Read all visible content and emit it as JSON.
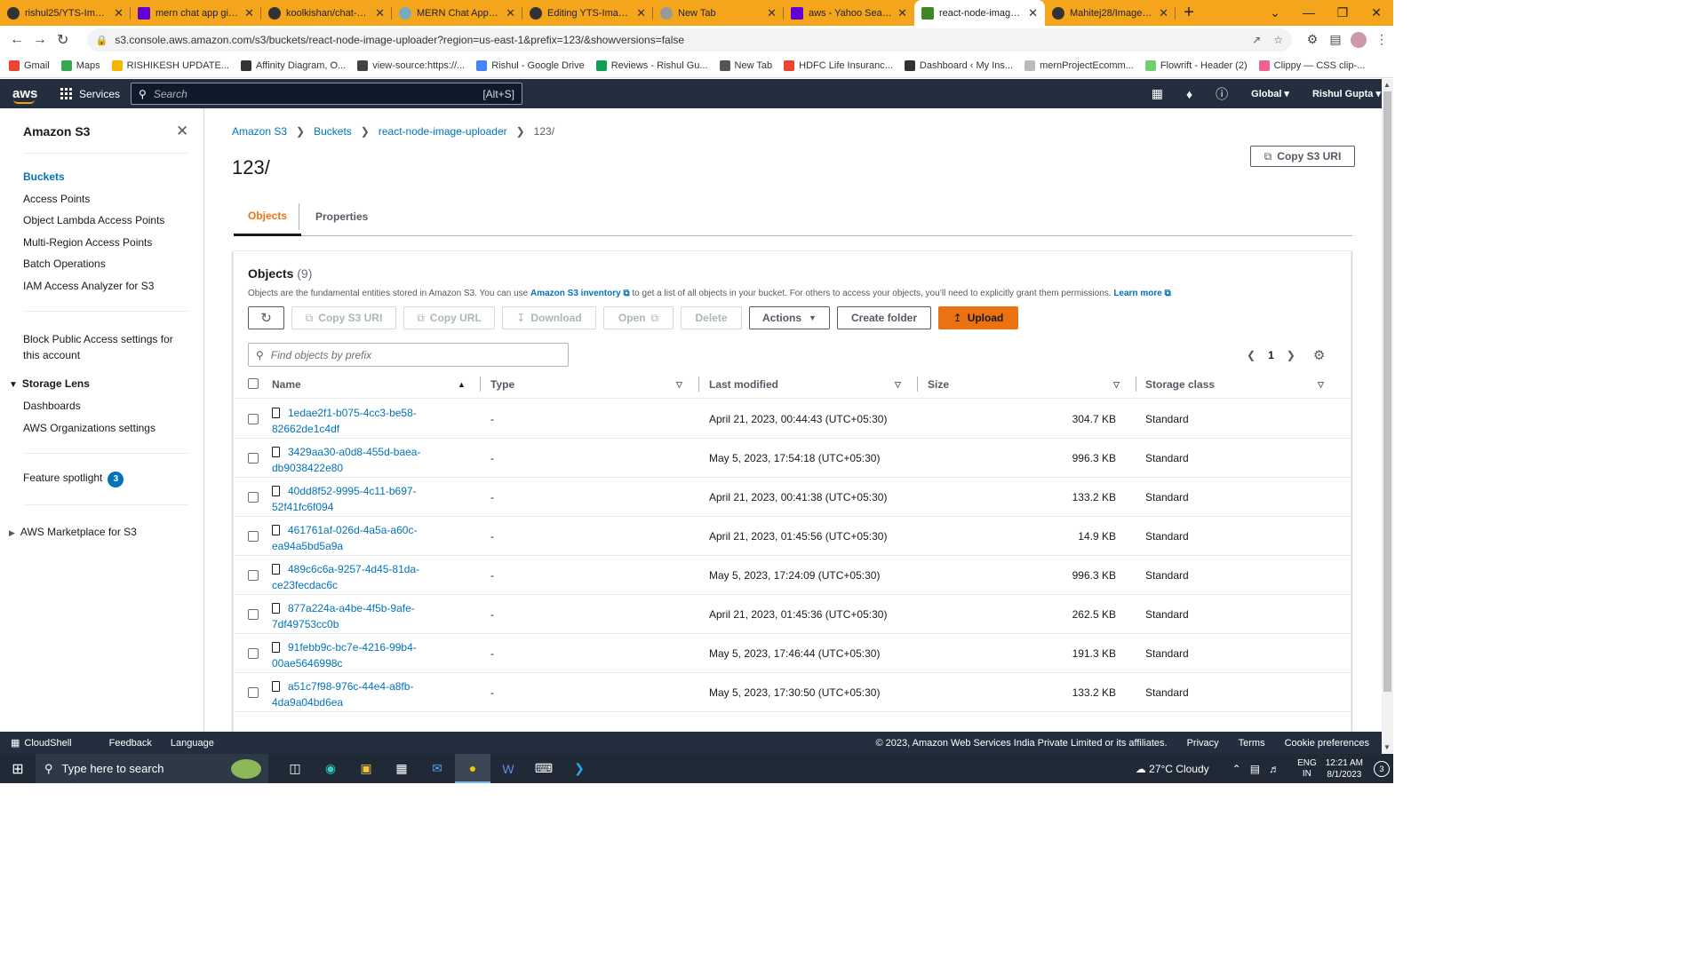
{
  "browser": {
    "tabs": [
      {
        "title": "rishul25/YTS-Image-U",
        "icon": "github-icon"
      },
      {
        "title": "mern chat app github",
        "icon": "yahoo-icon"
      },
      {
        "title": "koolkishan/chat-app-r",
        "icon": "github-icon"
      },
      {
        "title": "MERN Chat App Guide",
        "icon": "mern-icon"
      },
      {
        "title": "Editing YTS-Image-Up",
        "icon": "github-icon"
      },
      {
        "title": "New Tab",
        "icon": "globe-icon"
      },
      {
        "title": "aws - Yahoo Search Re",
        "icon": "yahoo-icon"
      },
      {
        "title": "react-node-image-upl",
        "icon": "s3-icon"
      },
      {
        "title": "Mahitej28/Image_uplo",
        "icon": "github-icon"
      }
    ],
    "url": "s3.console.aws.amazon.com/s3/buckets/react-node-image-uploader?region=us-east-1&prefix=123/&showversions=false",
    "bookmarks": [
      {
        "label": "Gmail",
        "color": "#ea4335"
      },
      {
        "label": "Maps",
        "color": "#34a853"
      },
      {
        "label": "RISHIKESH UPDATE...",
        "color": "#f4b400"
      },
      {
        "label": "Affinity Diagram, O...",
        "color": "#333333"
      },
      {
        "label": "view-source:https://...",
        "color": "#444444"
      },
      {
        "label": "Rishul - Google Drive",
        "color": "#4285f4"
      },
      {
        "label": "Reviews - Rishul Gu...",
        "color": "#0f9d58"
      },
      {
        "label": "New Tab",
        "color": "#555555"
      },
      {
        "label": "HDFC Life Insuranc...",
        "color": "#e8452c"
      },
      {
        "label": "Dashboard ‹ My Ins...",
        "color": "#333333"
      },
      {
        "label": "mernProjectEcomm...",
        "color": "#bbbbbb"
      },
      {
        "label": "Flowrift - Header (2)",
        "color": "#6ecf6e"
      },
      {
        "label": "Clippy — CSS clip-...",
        "color": "#f06292"
      }
    ]
  },
  "aws_nav": {
    "logo": "aws",
    "services": "Services",
    "search_placeholder": "Search",
    "search_shortcut": "[Alt+S]",
    "region": "Global ▾",
    "user": "Rishul Gupta ▾"
  },
  "sidenav": {
    "title": "Amazon S3",
    "items": [
      {
        "label": "Buckets",
        "active": true
      },
      {
        "label": "Access Points"
      },
      {
        "label": "Object Lambda Access Points"
      },
      {
        "label": "Multi-Region Access Points"
      },
      {
        "label": "Batch Operations"
      },
      {
        "label": "IAM Access Analyzer for S3"
      }
    ],
    "block_public_line1": "Block Public Access settings for",
    "block_public_line2": "this account",
    "storage_lens": "Storage Lens",
    "storage_lens_items": [
      "Dashboards",
      "AWS Organizations settings"
    ],
    "feature_spotlight": "Feature spotlight",
    "feature_badge": "3",
    "marketplace": "AWS Marketplace for S3"
  },
  "breadcrumbs": [
    "Amazon S3",
    "Buckets",
    "react-node-image-uploader",
    "123/"
  ],
  "page_title": "123/",
  "copy_s3_uri_top": "Copy S3 URI",
  "tabs": [
    "Objects",
    "Properties"
  ],
  "objects_panel": {
    "title": "Objects",
    "count": "(9)",
    "desc_pre": "Objects are the fundamental entities stored in Amazon S3. You can use ",
    "desc_link": "Amazon S3 inventory",
    "desc_mid": " to get a list of all objects in your bucket. For others to access your objects, you’ll need to explicitly grant them permissions. ",
    "desc_learn": "Learn more",
    "buttons": {
      "copy_s3_uri": "Copy S3 URI",
      "copy_url": "Copy URL",
      "download": "Download",
      "open": "Open",
      "delete": "Delete",
      "actions": "Actions",
      "create_folder": "Create folder",
      "upload": "Upload"
    },
    "search_placeholder": "Find objects by prefix",
    "page": "1",
    "columns": [
      "Name",
      "Type",
      "Last modified",
      "Size",
      "Storage class"
    ],
    "rows": [
      {
        "name1": "1edae2f1-b075-4cc3-be58-",
        "name2": "82662de1c4df",
        "type": "-",
        "modified": "April 21, 2023, 00:44:43 (UTC+05:30)",
        "size": "304.7 KB",
        "class": "Standard"
      },
      {
        "name1": "3429aa30-a0d8-455d-baea-",
        "name2": "db9038422e80",
        "type": "-",
        "modified": "May 5, 2023, 17:54:18 (UTC+05:30)",
        "size": "996.3 KB",
        "class": "Standard"
      },
      {
        "name1": "40dd8f52-9995-4c11-b697-",
        "name2": "52f41fc6f094",
        "type": "-",
        "modified": "April 21, 2023, 00:41:38 (UTC+05:30)",
        "size": "133.2 KB",
        "class": "Standard"
      },
      {
        "name1": "461761af-026d-4a5a-a60c-",
        "name2": "ea94a5bd5a9a",
        "type": "-",
        "modified": "April 21, 2023, 01:45:56 (UTC+05:30)",
        "size": "14.9 KB",
        "class": "Standard"
      },
      {
        "name1": "489c6c6a-9257-4d45-81da-",
        "name2": "ce23fecdac6c",
        "type": "-",
        "modified": "May 5, 2023, 17:24:09 (UTC+05:30)",
        "size": "996.3 KB",
        "class": "Standard"
      },
      {
        "name1": "877a224a-a4be-4f5b-9afe-",
        "name2": "7df49753cc0b",
        "type": "-",
        "modified": "April 21, 2023, 01:45:36 (UTC+05:30)",
        "size": "262.5 KB",
        "class": "Standard"
      },
      {
        "name1": "91febb9c-bc7e-4216-99b4-",
        "name2": "00ae5646998c",
        "type": "-",
        "modified": "May 5, 2023, 17:46:44 (UTC+05:30)",
        "size": "191.3 KB",
        "class": "Standard"
      },
      {
        "name1": "a51c7f98-976c-44e4-a8fb-",
        "name2": "4da9a04bd6ea",
        "type": "-",
        "modified": "May 5, 2023, 17:30:50 (UTC+05:30)",
        "size": "133.2 KB",
        "class": "Standard"
      }
    ]
  },
  "footer": {
    "cloudshell": "CloudShell",
    "feedback": "Feedback",
    "language": "Language",
    "copyright": "© 2023, Amazon Web Services India Private Limited or its affiliates.",
    "privacy": "Privacy",
    "terms": "Terms",
    "cookies": "Cookie preferences"
  },
  "taskbar": {
    "search_placeholder": "Type here to search",
    "weather": "27°C  Cloudy",
    "lang1": "ENG",
    "lang2": "IN",
    "time": "12:21 AM",
    "date": "8/1/2023",
    "notifications": "3"
  }
}
